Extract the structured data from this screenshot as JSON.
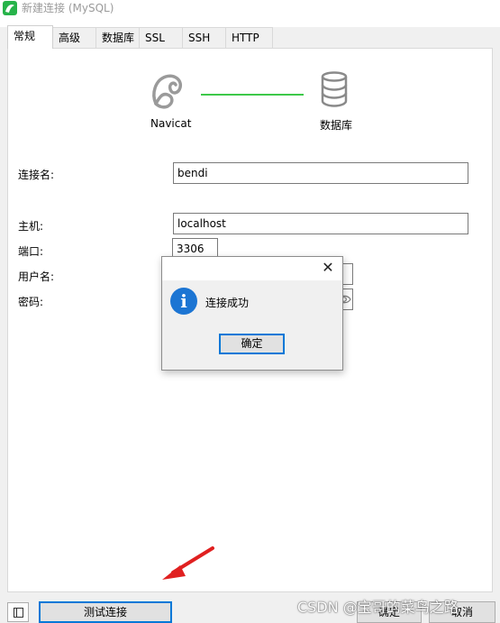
{
  "window": {
    "title": "新建连接 (MySQL)"
  },
  "tabs": [
    {
      "label": "常规",
      "active": true
    },
    {
      "label": "高级",
      "active": false
    },
    {
      "label": "数据库",
      "active": false
    },
    {
      "label": "SSL",
      "active": false
    },
    {
      "label": "SSH",
      "active": false
    },
    {
      "label": "HTTP",
      "active": false
    }
  ],
  "diagram": {
    "client_label": "Navicat",
    "server_label": "数据库",
    "connector_color": "#3ec94a"
  },
  "form": {
    "connection_name": {
      "label": "连接名:",
      "value": "bendi"
    },
    "host": {
      "label": "主机:",
      "value": "localhost"
    },
    "port": {
      "label": "端口:",
      "value": "3306"
    },
    "username": {
      "label": "用户名:",
      "value": ""
    },
    "password": {
      "label": "密码:",
      "value": ""
    }
  },
  "dialog": {
    "message": "连接成功",
    "ok_label": "确定",
    "icon": "info-icon",
    "close_glyph": "✕"
  },
  "footer": {
    "test_label": "测试连接",
    "ok_label": "确定",
    "cancel_label": "取消"
  },
  "watermark": "CSDN @宝哥的菜鸟之路",
  "colors": {
    "accent": "#0078d7",
    "info": "#1c75d3",
    "arrow": "#e02020",
    "app_icon": "#27b34a"
  }
}
